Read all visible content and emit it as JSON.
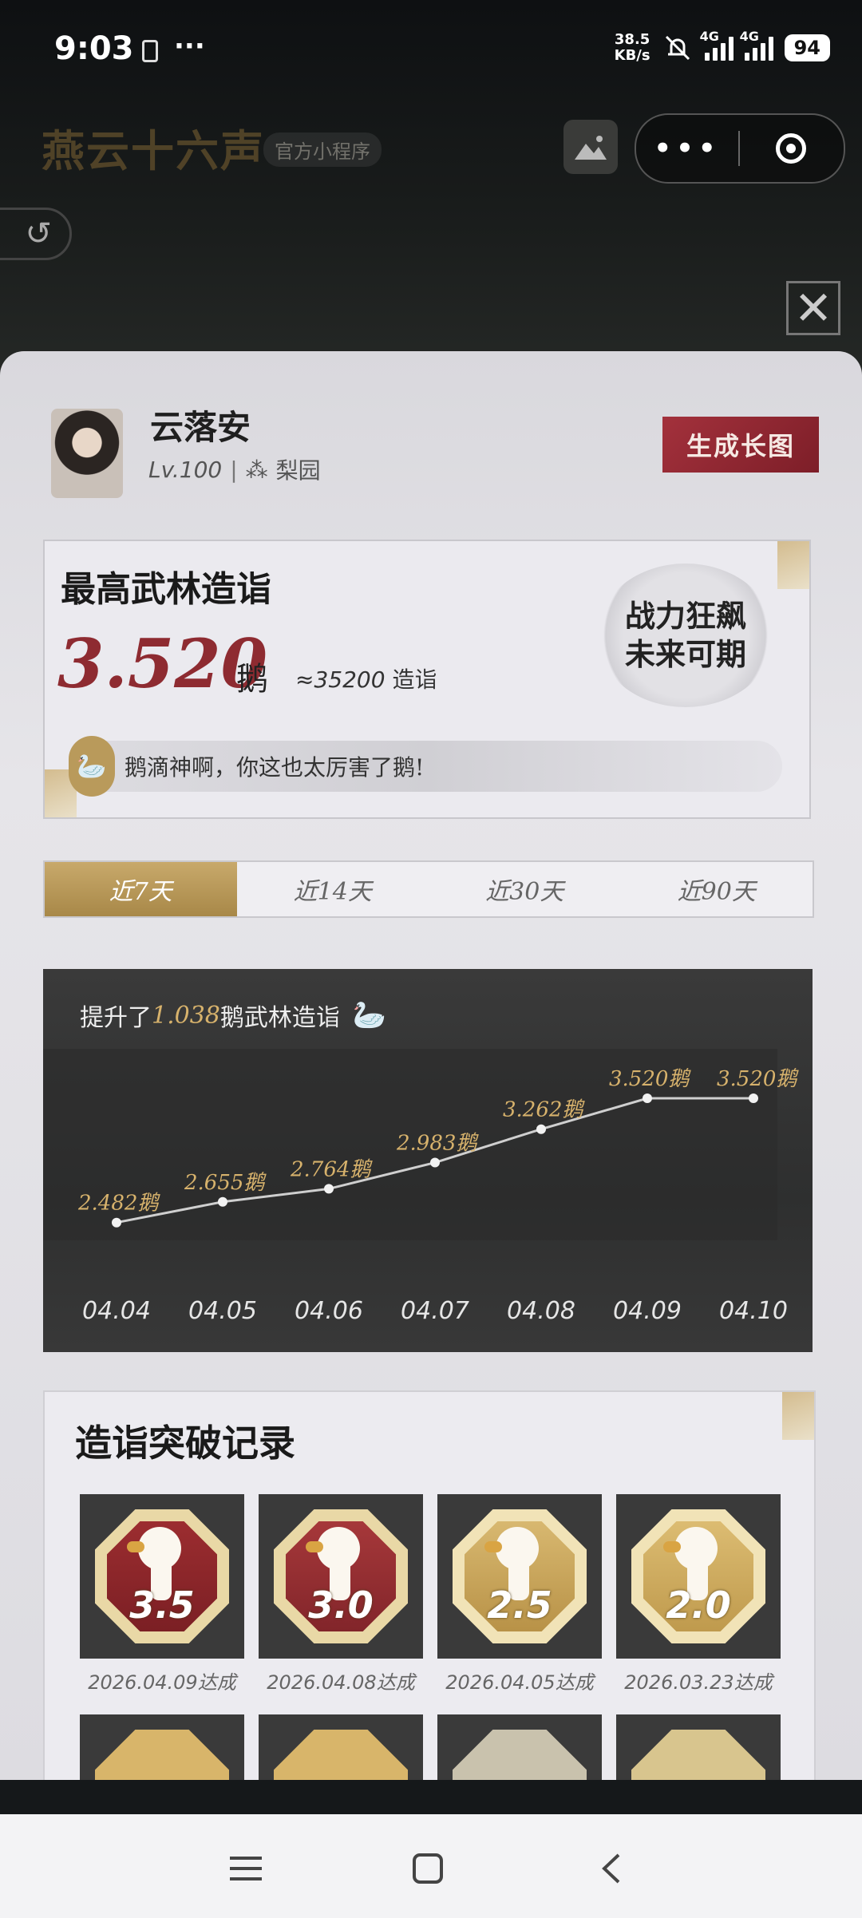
{
  "status_bar": {
    "time": "9:03",
    "more": "···",
    "net_speed_value": "38.5",
    "net_speed_unit": "KB/s",
    "signal1_label": "4G",
    "signal2_label": "4G",
    "battery": "94"
  },
  "header": {
    "logo_text": "燕云十六声",
    "mini_program_badge": "官方小程序",
    "more_label": "•••"
  },
  "profile": {
    "name": "云落安",
    "level": "Lv.100",
    "separator": "|",
    "server": "梨园",
    "generate_button": "生成长图"
  },
  "score_card": {
    "title": "最高武林造诣",
    "value": "3.520",
    "unit": "鹅",
    "approx_prefix": "≈",
    "approx_value": "35200",
    "approx_unit": "造诣",
    "slogan_line1": "战力狂飙",
    "slogan_line2": "未来可期",
    "quote": "鹅滴神啊，你这也太厉害了鹅!"
  },
  "tabs": [
    {
      "label": "近7天",
      "active": true
    },
    {
      "label": "近14天",
      "active": false
    },
    {
      "label": "近30天",
      "active": false
    },
    {
      "label": "近90天",
      "active": false
    }
  ],
  "chart_header": {
    "prefix": "提升了",
    "value": "1.038",
    "suffix": "鹅武林造诣"
  },
  "chart_data": {
    "type": "line",
    "categories": [
      "04.04",
      "04.05",
      "04.06",
      "04.07",
      "04.08",
      "04.09",
      "04.10"
    ],
    "values": [
      2.482,
      2.655,
      2.764,
      2.983,
      3.262,
      3.52,
      3.52
    ],
    "data_labels": [
      "2.482鹅",
      "2.655鹅",
      "2.764鹅",
      "2.983鹅",
      "3.262鹅",
      "3.520鹅",
      "3.520鹅"
    ],
    "ylim": [
      2.2,
      3.7
    ],
    "colors": {
      "line": "#cfcfcf",
      "label": "#d7b26c",
      "tick": "#e6e6e6"
    }
  },
  "records": {
    "title": "造诣突破记录",
    "items": [
      {
        "level": "3.5",
        "date": "2026.04.09达成",
        "theme": "red"
      },
      {
        "level": "3.0",
        "date": "2026.04.08达成",
        "theme": "red"
      },
      {
        "level": "2.5",
        "date": "2026.04.05达成",
        "theme": "gold"
      },
      {
        "level": "2.0",
        "date": "2026.03.23达成",
        "theme": "gold"
      }
    ]
  },
  "colors": {
    "accent_gold": "#c8a96b",
    "accent_red": "#8e2b31"
  }
}
